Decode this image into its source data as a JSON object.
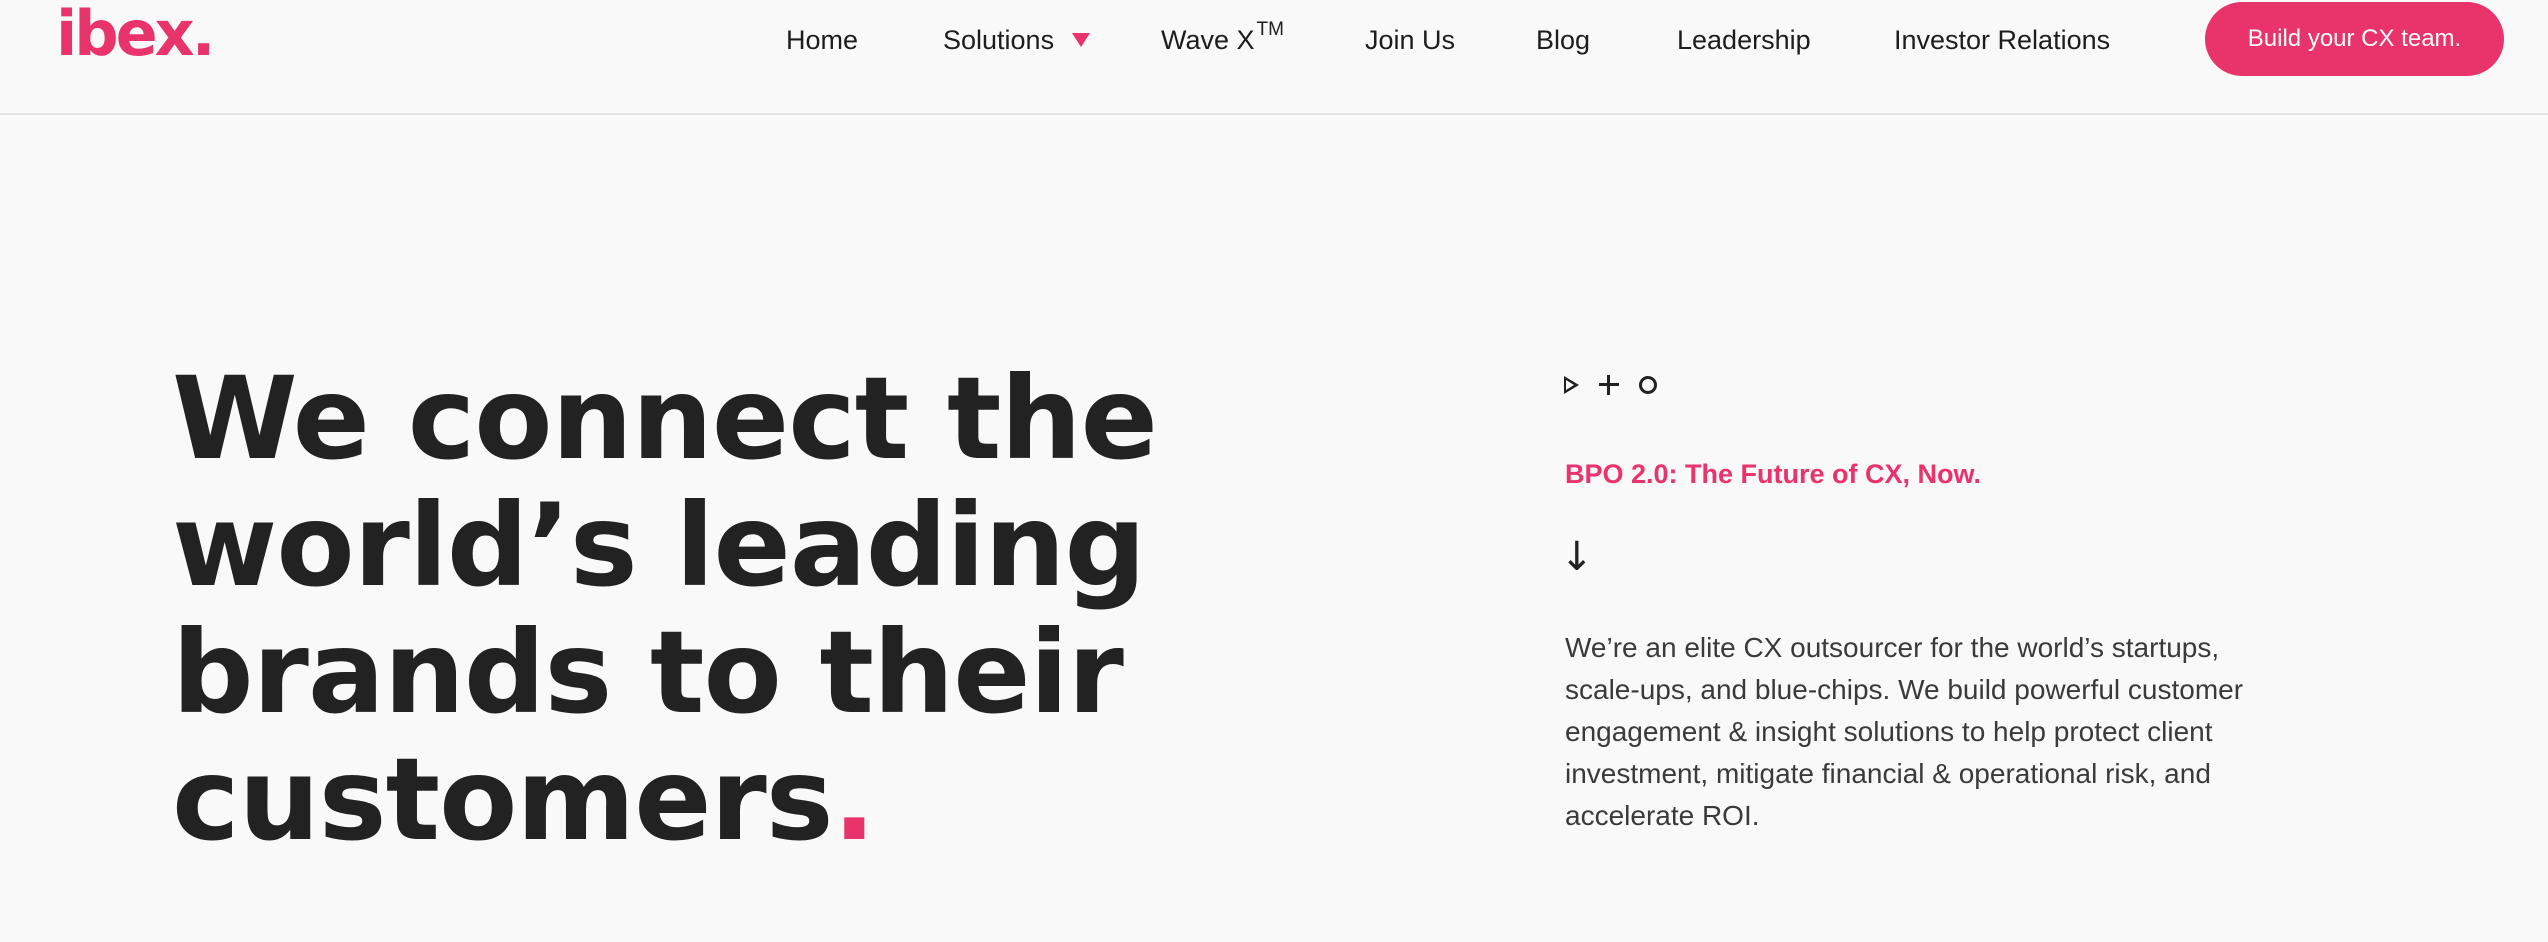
{
  "brand": {
    "logo_text": "ibex",
    "logo_dot": ".",
    "accent_color": "#e8336b"
  },
  "nav": {
    "home": "Home",
    "solutions": "Solutions",
    "wave_x": "Wave X",
    "wave_x_tm": "TM",
    "join_us": "Join Us",
    "blog": "Blog",
    "leadership": "Leadership",
    "investor_relations": "Investor Relations"
  },
  "cta": {
    "label": "Build your CX team."
  },
  "hero": {
    "line1": "We connect the",
    "line2": "world’s leading",
    "line3": "brands to their",
    "line4": "customers",
    "period": ".",
    "icons": [
      "play-outline-icon",
      "plus-icon",
      "circle-icon"
    ],
    "tagline": "BPO 2.0: The Future of CX, Now.",
    "arrow": "↓",
    "description": "We’re an elite CX outsourcer for the world’s startups, scale-ups, and blue-chips. We build powerful customer engagement & insight solutions to help protect client investment, mitigate financial & operational risk, and accelerate ROI."
  }
}
